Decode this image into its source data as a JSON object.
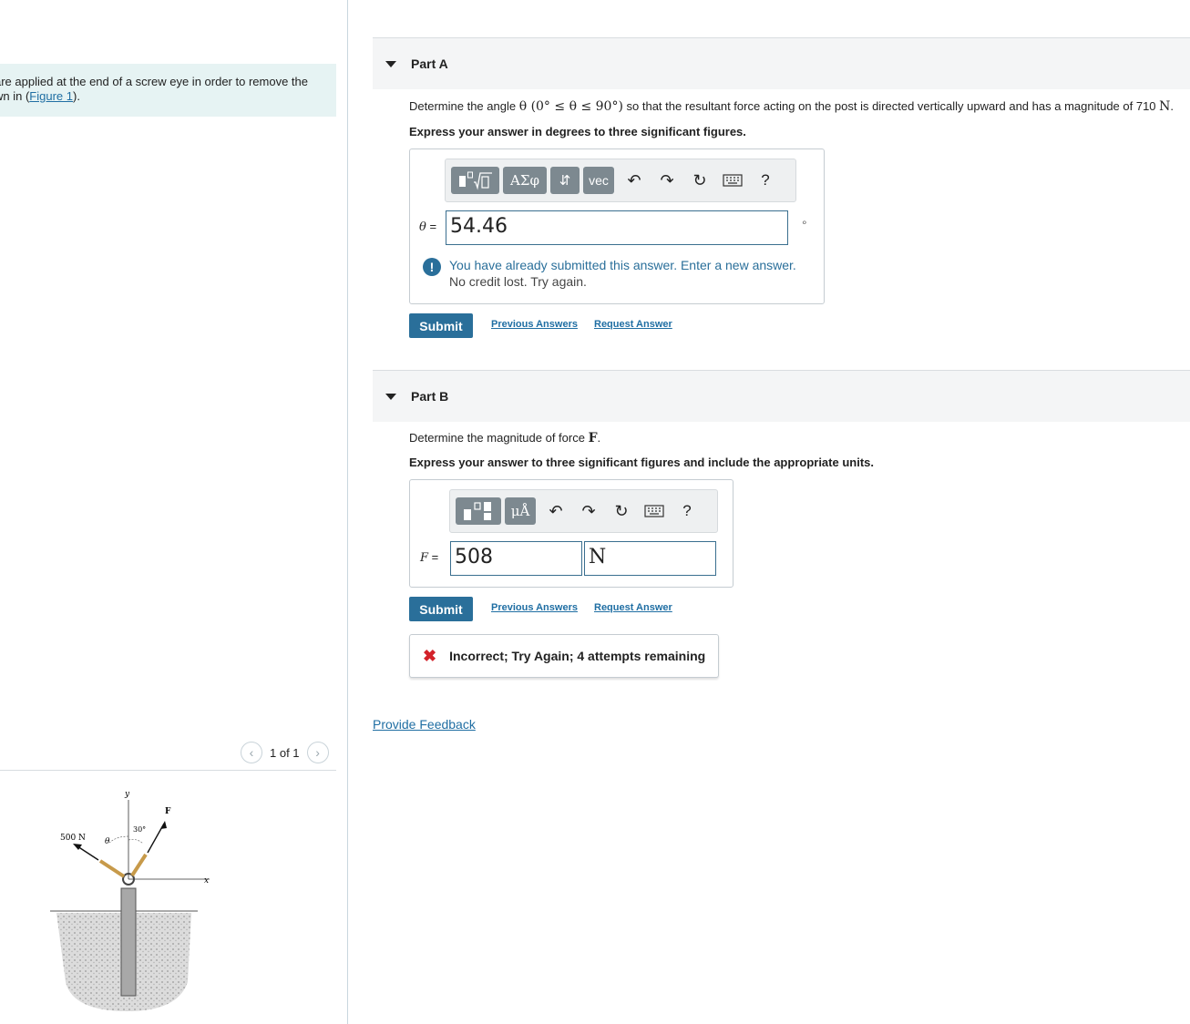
{
  "problem": {
    "line1": "are applied at the end of a screw eye in order to remove the",
    "line2_prefix": "wn in (",
    "figure_link": "Figure 1",
    "line2_suffix": ")."
  },
  "figure_pager": {
    "prev_icon": "chevron-left-icon",
    "label": "1 of 1",
    "next_icon": "chevron-right-icon"
  },
  "figure": {
    "force_500_label": "500 N",
    "force_F_label": "F",
    "theta_label": "θ",
    "angle_label": "30°",
    "y_axis_label": "y",
    "x_axis_label": "x"
  },
  "part_a": {
    "title": "Part A",
    "question_prefix": "Determine the angle ",
    "question_math": "θ (0° ≤ θ ≤ 90°)",
    "question_mid": " so that the resultant force acting on the post is directed vertically upward and has a magnitude of 710 ",
    "question_unit": "N",
    "question_end": ".",
    "instruction": "Express your answer in degrees to three significant figures.",
    "toolbar": {
      "templates_icon": "templates-icon",
      "greek_label": "ΑΣφ",
      "arrows_label": "⇵",
      "vec_label": "vec",
      "undo_icon": "undo-icon",
      "redo_icon": "redo-icon",
      "reset_icon": "reset-icon",
      "keyboard_icon": "keyboard-icon",
      "help_label": "?"
    },
    "variable": "θ",
    "equals": " =",
    "answer_value": "54.46",
    "unit_symbol": "∘",
    "warning_line1": "You have already submitted this answer. Enter a new answer.",
    "warning_line2": "No credit lost. Try again.",
    "submit_label": "Submit",
    "previous_answers_label": "Previous Answers",
    "request_answer_label": "Request Answer"
  },
  "part_b": {
    "title": "Part B",
    "question_prefix": "Determine the magnitude of force ",
    "question_math": "F",
    "question_end": ".",
    "instruction": "Express your answer to three significant figures and include the appropriate units.",
    "toolbar": {
      "templates_icon": "templates-icon",
      "units_label": "μÅ",
      "undo_icon": "undo-icon",
      "redo_icon": "redo-icon",
      "reset_icon": "reset-icon",
      "keyboard_icon": "keyboard-icon",
      "help_label": "?"
    },
    "variable": "F",
    "equals": " =",
    "answer_value": "508",
    "answer_unit": "N",
    "submit_label": "Submit",
    "previous_answers_label": "Previous Answers",
    "request_answer_label": "Request Answer",
    "incorrect_message": "Incorrect; Try Again; 4 attempts remaining"
  },
  "feedback_label": "Provide Feedback",
  "colors": {
    "accent": "#2a6f9a",
    "link": "#1f6ea3",
    "error": "#d3222a",
    "problem_bg": "#e6f3f3"
  }
}
